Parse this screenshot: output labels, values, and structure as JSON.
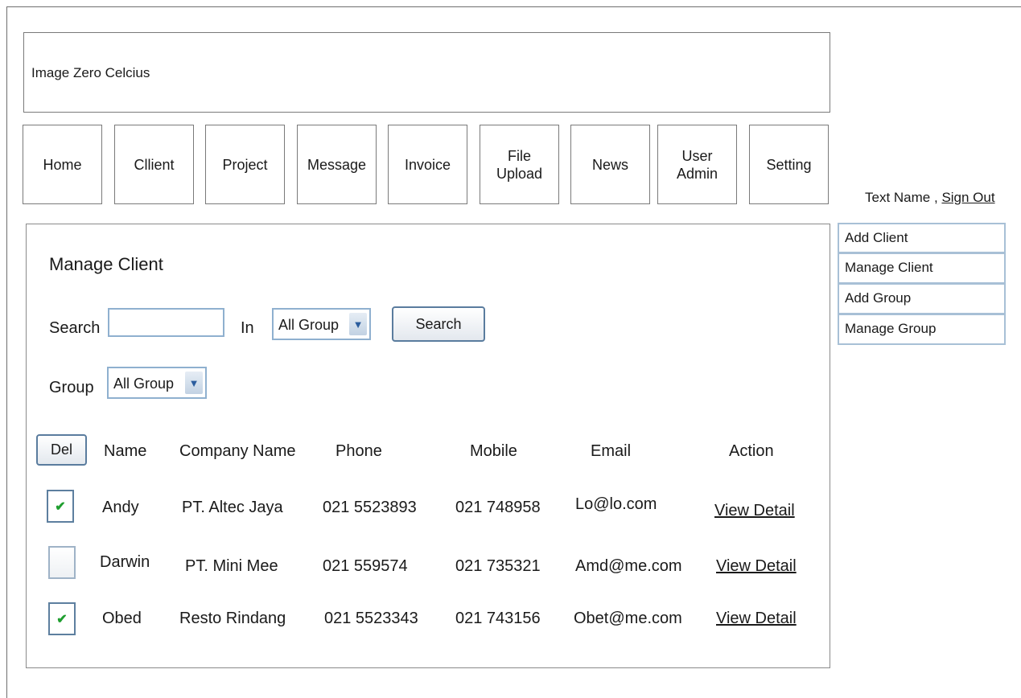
{
  "app": {
    "title": "Image Zero Celcius"
  },
  "nav": {
    "items": [
      {
        "label": "Home"
      },
      {
        "label": "Cllient"
      },
      {
        "label": "Project"
      },
      {
        "label": "Message"
      },
      {
        "label": "Invoice"
      },
      {
        "label": "File\nUpload"
      },
      {
        "label": "News"
      },
      {
        "label": "User\nAdmin"
      },
      {
        "label": "Setting"
      }
    ]
  },
  "user": {
    "name": "Text Name ,",
    "sign_out": "Sign Out"
  },
  "side_menu": {
    "items": [
      {
        "label": "Add Client"
      },
      {
        "label": "Manage Client"
      },
      {
        "label": "Add Group"
      },
      {
        "label": "Manage Group"
      }
    ]
  },
  "panel": {
    "title": "Manage Client",
    "search_label": "Search",
    "search_value": "",
    "in_label": "In",
    "in_select": "All Group",
    "search_button": "Search",
    "group_label": "Group",
    "group_select": "All Group",
    "del_button": "Del"
  },
  "table": {
    "headers": {
      "name": "Name",
      "company": "Company Name",
      "phone": "Phone",
      "mobile": "Mobile",
      "email": "Email",
      "action": "Action"
    },
    "rows": [
      {
        "checked": true,
        "name": "Andy",
        "company": "PT. Altec Jaya",
        "phone": "021 5523893",
        "mobile": "021 748958",
        "email": "Lo@lo.com",
        "action": "View Detail"
      },
      {
        "checked": false,
        "name": "Darwin",
        "company": "PT. Mini Mee",
        "phone": "021 559574",
        "mobile": "021 735321",
        "email": "Amd@me.com",
        "action": "View Detail"
      },
      {
        "checked": true,
        "name": "Obed",
        "company": "Resto Rindang",
        "phone": "021 5523343",
        "mobile": "021 743156",
        "email": "Obet@me.com",
        "action": "View Detail"
      }
    ]
  },
  "icons": {
    "check": "check-icon",
    "dropdown": "chevron-down-icon"
  },
  "colors": {
    "check": "#1f9e2f",
    "field_border": "#8fb0cf",
    "button_border": "#5a7c9e"
  }
}
